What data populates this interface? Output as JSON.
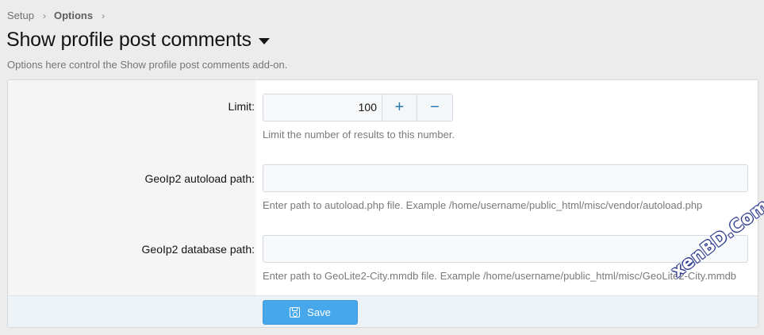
{
  "breadcrumb": {
    "items": [
      "Setup",
      "Options"
    ],
    "separator": "›"
  },
  "header": {
    "title": "Show profile post comments",
    "description": "Options here control the Show profile post comments add-on."
  },
  "form": {
    "limit": {
      "label": "Limit:",
      "value": "100",
      "plus": "+",
      "minus": "−",
      "hint": "Limit the number of results to this number."
    },
    "autoload_path": {
      "label": "GeoIp2 autoload path:",
      "value": "",
      "hint": "Enter path to autoload.php file. Example /home/username/public_html/misc/vendor/autoload.php"
    },
    "database_path": {
      "label": "GeoIp2 database path:",
      "value": "",
      "hint": "Enter path to GeoLite2-City.mmdb file. Example /home/username/public_html/misc/GeoLite2-City.mmdb"
    },
    "save_label": "Save"
  },
  "watermark": {
    "text": "xenBD.Com"
  },
  "colors": {
    "accent": "#47a7eb",
    "link": "#2577b1"
  }
}
